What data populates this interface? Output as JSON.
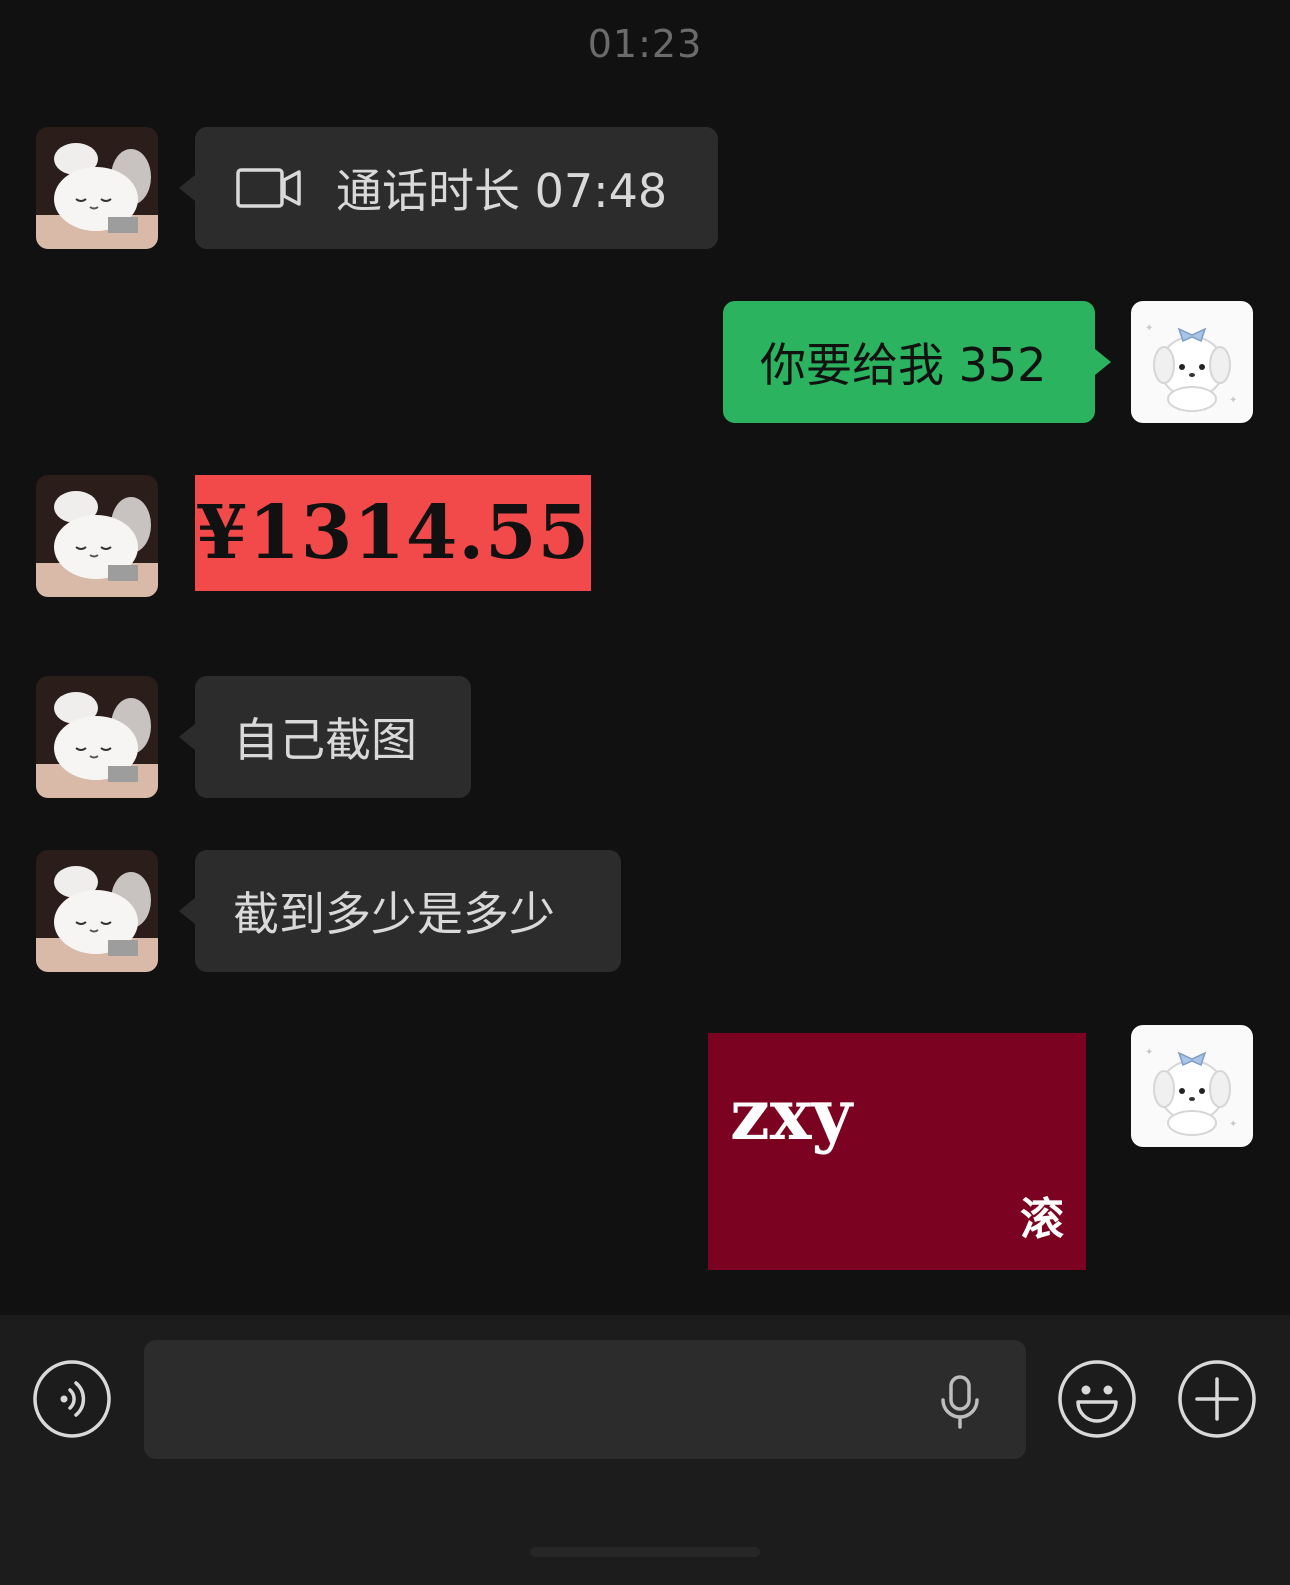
{
  "timestamp": "01:23",
  "contact": {
    "avatar_icon": "bunny-plush-avatar"
  },
  "me": {
    "avatar_icon": "white-puppy-avatar"
  },
  "messages": [
    {
      "sender": "contact",
      "type": "call",
      "icon": "video-call-icon",
      "text": "通话时长 07:48"
    },
    {
      "sender": "me",
      "type": "text",
      "text": "你要给我 352"
    },
    {
      "sender": "contact",
      "type": "image",
      "text": "¥1314.55"
    },
    {
      "sender": "contact",
      "type": "text",
      "text": "自己截图"
    },
    {
      "sender": "contact",
      "type": "text",
      "text": "截到多少是多少"
    },
    {
      "sender": "me",
      "type": "sticker",
      "line1": "zxy",
      "line2": "滚"
    }
  ],
  "input_bar": {
    "voice_icon": "voice-toggle-icon",
    "mic_icon": "microphone-icon",
    "emoji_icon": "emoji-icon",
    "plus_icon": "plus-icon"
  },
  "colors": {
    "background": "#111111",
    "incoming_bubble": "#2c2c2c",
    "outgoing_bubble": "#2cb360",
    "money_image": "#f24a4a",
    "sticker": "#7b0220"
  }
}
